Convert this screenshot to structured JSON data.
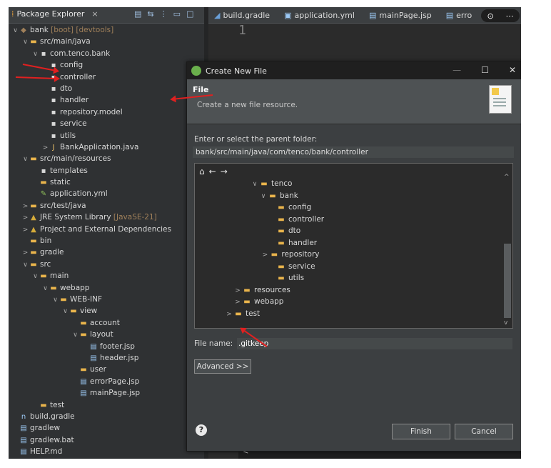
{
  "explorer": {
    "tab_label": "Package Explorer",
    "close": "×",
    "tools": [
      "▤",
      "⇆",
      "⋮",
      "▭",
      "□"
    ],
    "tree": [
      {
        "indent": 0,
        "tw": "∨",
        "icon": "project",
        "text": "bank",
        "deco": " [boot] [devtools]"
      },
      {
        "indent": 1,
        "tw": "∨",
        "icon": "folder",
        "text": "src/main/java",
        "deco": ""
      },
      {
        "indent": 2,
        "tw": "∨",
        "icon": "pkg",
        "text": "com.tenco.bank",
        "deco": ""
      },
      {
        "indent": 3,
        "tw": "",
        "icon": "pkg",
        "text": "config",
        "deco": ""
      },
      {
        "indent": 3,
        "tw": "",
        "icon": "pkg",
        "text": "controller",
        "deco": ""
      },
      {
        "indent": 3,
        "tw": "",
        "icon": "pkg",
        "text": "dto",
        "deco": ""
      },
      {
        "indent": 3,
        "tw": "",
        "icon": "pkg",
        "text": "handler",
        "deco": ""
      },
      {
        "indent": 3,
        "tw": "",
        "icon": "pkg",
        "text": "repository.model",
        "deco": ""
      },
      {
        "indent": 3,
        "tw": "",
        "icon": "pkg",
        "text": "service",
        "deco": ""
      },
      {
        "indent": 3,
        "tw": "",
        "icon": "pkg",
        "text": "utils",
        "deco": ""
      },
      {
        "indent": 3,
        "tw": ">",
        "icon": "java",
        "text": "BankApplication.java",
        "deco": ""
      },
      {
        "indent": 1,
        "tw": "∨",
        "icon": "folder",
        "text": "src/main/resources",
        "deco": ""
      },
      {
        "indent": 2,
        "tw": "",
        "icon": "pkg",
        "text": "templates",
        "deco": ""
      },
      {
        "indent": 2,
        "tw": "",
        "icon": "folder",
        "text": "static",
        "deco": ""
      },
      {
        "indent": 2,
        "tw": "",
        "icon": "yml",
        "text": "application.yml",
        "deco": ""
      },
      {
        "indent": 1,
        "tw": ">",
        "icon": "folder",
        "text": "src/test/java",
        "deco": ""
      },
      {
        "indent": 1,
        "tw": ">",
        "icon": "lib",
        "text": "JRE System Library",
        "deco": " [JavaSE-21]"
      },
      {
        "indent": 1,
        "tw": ">",
        "icon": "lib",
        "text": "Project and External Dependencies",
        "deco": ""
      },
      {
        "indent": 1,
        "tw": "",
        "icon": "folder",
        "text": "bin",
        "deco": ""
      },
      {
        "indent": 1,
        "tw": ">",
        "icon": "folder",
        "text": "gradle",
        "deco": ""
      },
      {
        "indent": 1,
        "tw": "∨",
        "icon": "folder",
        "text": "src",
        "deco": ""
      },
      {
        "indent": 2,
        "tw": "∨",
        "icon": "folder",
        "text": "main",
        "deco": ""
      },
      {
        "indent": 3,
        "tw": "∨",
        "icon": "folder",
        "text": "webapp",
        "deco": ""
      },
      {
        "indent": 4,
        "tw": "∨",
        "icon": "folder",
        "text": "WEB-INF",
        "deco": ""
      },
      {
        "indent": 5,
        "tw": "∨",
        "icon": "folder",
        "text": "view",
        "deco": ""
      },
      {
        "indent": 6,
        "tw": "",
        "icon": "folder",
        "text": "account",
        "deco": ""
      },
      {
        "indent": 6,
        "tw": "∨",
        "icon": "folder",
        "text": "layout",
        "deco": ""
      },
      {
        "indent": 7,
        "tw": "",
        "icon": "file",
        "text": "footer.jsp",
        "deco": ""
      },
      {
        "indent": 7,
        "tw": "",
        "icon": "file",
        "text": "header.jsp",
        "deco": ""
      },
      {
        "indent": 6,
        "tw": "",
        "icon": "folder",
        "text": "user",
        "deco": ""
      },
      {
        "indent": 6,
        "tw": "",
        "icon": "file",
        "text": "errorPage.jsp",
        "deco": ""
      },
      {
        "indent": 6,
        "tw": "",
        "icon": "file",
        "text": "mainPage.jsp",
        "deco": ""
      },
      {
        "indent": 2,
        "tw": "",
        "icon": "folder",
        "text": "test",
        "deco": ""
      },
      {
        "indent": 0,
        "tw": "",
        "icon": "gradle",
        "text": "build.gradle",
        "deco": ""
      },
      {
        "indent": 0,
        "tw": "",
        "icon": "file",
        "text": "gradlew",
        "deco": ""
      },
      {
        "indent": 0,
        "tw": "",
        "icon": "file",
        "text": "gradlew.bat",
        "deco": ""
      },
      {
        "indent": 0,
        "tw": "",
        "icon": "file",
        "text": "HELP.md",
        "deco": ""
      }
    ]
  },
  "editor": {
    "tabs": [
      "build.gradle",
      "application.yml",
      "mainPage.jsp",
      "erro"
    ],
    "line_number": "1",
    "overlay_icons": [
      "⊙",
      "⋯"
    ],
    "bottom_marker": "<"
  },
  "dialog": {
    "title": "Create New File",
    "controls": [
      "—",
      "☐",
      "✕"
    ],
    "header_title": "File",
    "header_subtitle": "Create a new file resource.",
    "parent_label": "Enter or select the parent folder:",
    "parent_path": "bank/src/main/java/com/tenco/bank/controller",
    "nav_icons": [
      "⌂",
      "←",
      "→"
    ],
    "folder_tree": [
      {
        "indent": 6,
        "tw": "∨",
        "text": "tenco"
      },
      {
        "indent": 7,
        "tw": "∨",
        "text": "bank"
      },
      {
        "indent": 8,
        "tw": "",
        "text": "config"
      },
      {
        "indent": 8,
        "tw": "",
        "text": "controller"
      },
      {
        "indent": 8,
        "tw": "",
        "text": "dto"
      },
      {
        "indent": 8,
        "tw": "",
        "text": "handler"
      },
      {
        "indent": 7.2,
        "tw": ">",
        "text": "repository"
      },
      {
        "indent": 8,
        "tw": "",
        "text": "service"
      },
      {
        "indent": 8,
        "tw": "",
        "text": "utils"
      },
      {
        "indent": 4,
        "tw": ">",
        "text": "resources"
      },
      {
        "indent": 4,
        "tw": ">",
        "text": "webapp"
      },
      {
        "indent": 3,
        "tw": ">",
        "text": "test"
      }
    ],
    "file_name_label": "File name:",
    "file_name_value": ".gitkeep",
    "advanced_button": "Advanced >>",
    "help_icon": "?",
    "finish_button": "Finish",
    "cancel_button": "Cancel"
  }
}
